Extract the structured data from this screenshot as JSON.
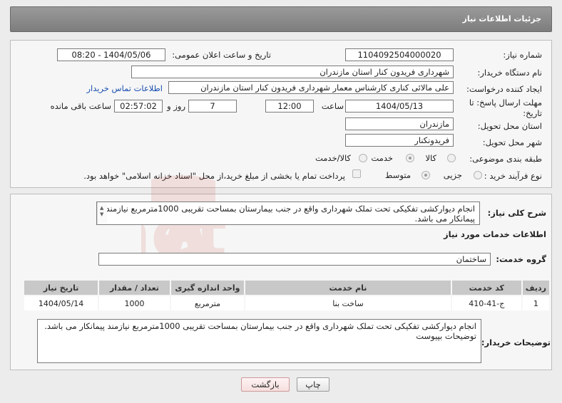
{
  "header": {
    "title": "جزئیات اطلاعات نیاز"
  },
  "form": {
    "need_number_label": "شماره نیاز:",
    "need_number": "1104092504000020",
    "announce_label": "تاریخ و ساعت اعلان عمومی:",
    "announce_value": "1404/05/06 - 08:20",
    "buyer_org_label": "نام دستگاه خریدار:",
    "buyer_org": "شهرداری فریدون کنار استان مازندران",
    "creator_label": "ایجاد کننده درخواست:",
    "creator": "علی مالائی کناری کارشناس معمار شهرداری فریدون کنار استان مازندران",
    "contact_link": "اطلاعات تماس خریدار",
    "deadline_label_1": "مهلت ارسال پاسخ: تا",
    "deadline_label_2": "تاریخ:",
    "deadline_date": "1404/05/13",
    "time_label": "ساعت",
    "deadline_time": "12:00",
    "days_value": "7",
    "days_label": "روز و",
    "remaining_time": "02:57:02",
    "remaining_label": "ساعت باقی مانده",
    "province_label": "استان محل تحویل:",
    "province": "مازندران",
    "city_label": "شهر محل تحویل:",
    "city": "فریدونکنار",
    "category_label": "طبقه بندی موضوعی:",
    "category_options": [
      "کالا",
      "خدمت",
      "کالا/خدمت"
    ],
    "category_selected": "خدمت",
    "process_label": "نوع فرآیند خرید :",
    "process_options": [
      "جزیی",
      "متوسط"
    ],
    "process_selected": "متوسط",
    "payment_note": "پرداخت تمام یا بخشی از مبلغ خرید،از محل \"اسناد خزانه اسلامی\" خواهد بود."
  },
  "summary": {
    "label": "شرح کلی نیاز:",
    "text": "انجام دیوارکشی تفکیکی تحت تملک شهرداری واقع در جنب بیمارستان بمساحت تقریبی 1000مترمربع نیازمند پیمانکار می باشد."
  },
  "services": {
    "section_title": "اطلاعات خدمات مورد نیاز",
    "group_label": "گروه خدمت:",
    "group_value": "ساختمان",
    "table": {
      "headers": [
        "ردیف",
        "کد خدمت",
        "نام خدمت",
        "واحد اندازه گیری",
        "تعداد / مقدار",
        "تاریخ نیاز"
      ],
      "rows": [
        [
          "1",
          "ج-41-410",
          "ساخت بنا",
          "مترمربع",
          "1000",
          "1404/05/14"
        ]
      ]
    }
  },
  "buyer_notes": {
    "label": "توضیحات خریدار:",
    "line1": "انجام دیوارکشی تفکیکی تحت تملک شهرداری واقع در جنب بیمارستان بمساحت تقریبی 1000مترمربع نیازمند پیمانکار می باشد.",
    "line2": "توضیحات بپیوست"
  },
  "buttons": {
    "print": "چاپ",
    "back": "بازگشت"
  },
  "watermark": {
    "text": "AriaTender.net"
  }
}
